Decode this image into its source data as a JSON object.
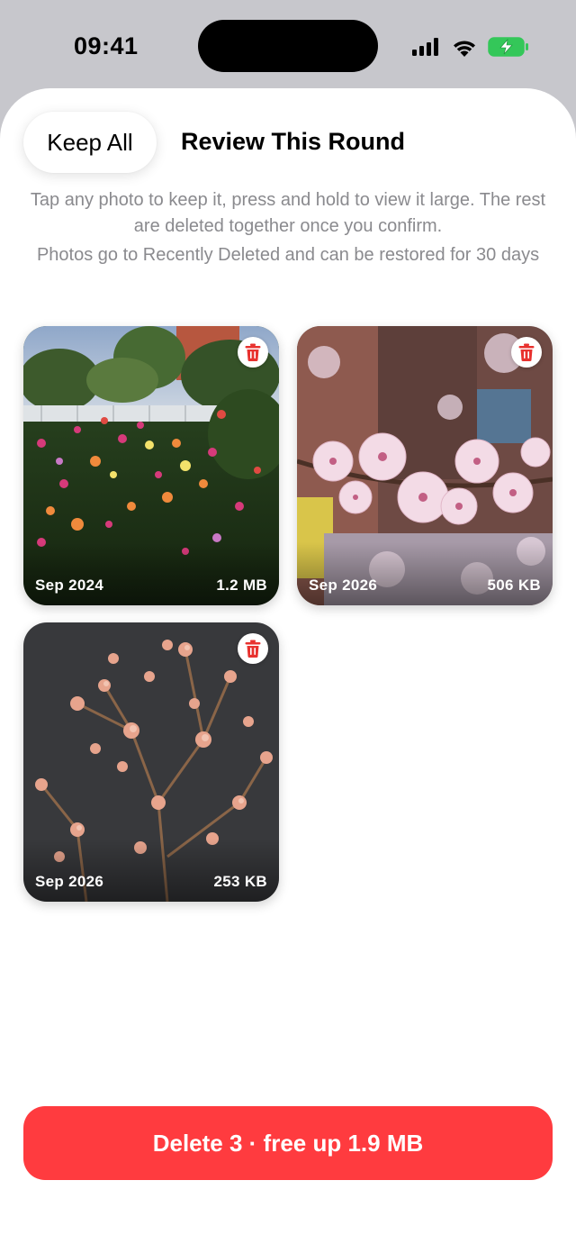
{
  "status_bar": {
    "time": "09:41"
  },
  "header": {
    "keep_all_label": "Keep All",
    "title": "Review This Round"
  },
  "description": {
    "line1": "Tap any photo to keep it, press and hold to view it large. The rest are deleted together once you confirm.",
    "line2": "Photos go to Recently Deleted and can be restored for 30 days"
  },
  "photos": [
    {
      "date": "Sep 2024",
      "size": "1.2 MB",
      "subject": "rose garden"
    },
    {
      "date": "Sep 2026",
      "size": "506 KB",
      "subject": "pink blossoms"
    },
    {
      "date": "Sep 2026",
      "size": "253 KB",
      "subject": "magnolia at night"
    }
  ],
  "footer": {
    "delete_label": "Delete 3 · free up 1.9 MB"
  },
  "colors": {
    "accent": "#ff3b3f",
    "battery": "#34c759"
  }
}
